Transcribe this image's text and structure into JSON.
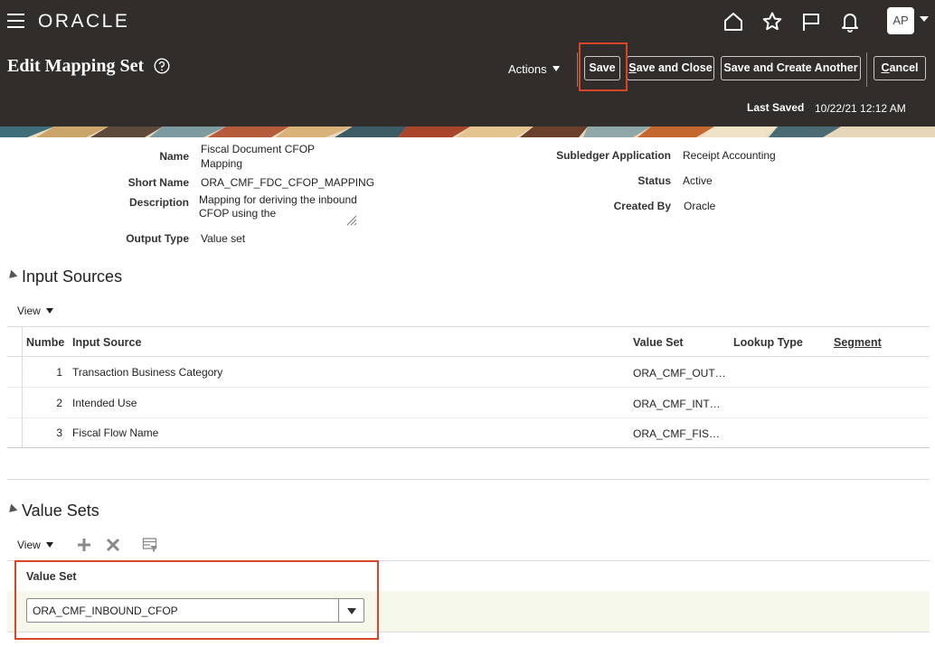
{
  "header": {
    "brand": "ORACLE",
    "avatar_initials": "AP",
    "page_title": "Edit Mapping Set",
    "actions_label": "Actions",
    "buttons": {
      "save": "Save",
      "save_close_first": "S",
      "save_close_rest": "ave and Close",
      "save_create": "Save and Create Another",
      "cancel_first": "C",
      "cancel_rest": "ancel"
    },
    "last_saved_label": "Last Saved",
    "last_saved_value": "10/22/21 12:12 AM"
  },
  "form": {
    "name_label": "Name",
    "name_line1": "Fiscal Document CFOP",
    "name_line2": "Mapping",
    "short_name_label": "Short Name",
    "short_name_value": "ORA_CMF_FDC_CFOP_MAPPING",
    "description_label": "Description",
    "description_value": "Mapping for deriving the inbound CFOP using the",
    "output_type_label": "Output Type",
    "output_type_value": "Value set",
    "subledger_label": "Subledger Application",
    "subledger_value": "Receipt Accounting",
    "status_label": "Status",
    "status_value": "Active",
    "created_by_label": "Created By",
    "created_by_value": "Oracle"
  },
  "input_sources": {
    "title": "Input Sources",
    "view_label": "View",
    "columns": {
      "number": "Numbe",
      "input_source": "Input Source",
      "value_set": "Value Set",
      "lookup_type": "Lookup Type",
      "segment": "Segment"
    },
    "rows": [
      {
        "number": "1",
        "input_source": "Transaction Business Category",
        "value_set": "ORA_CMF_OUT…"
      },
      {
        "number": "2",
        "input_source": "Intended Use",
        "value_set": "ORA_CMF_INT…"
      },
      {
        "number": "3",
        "input_source": "Fiscal Flow Name",
        "value_set": "ORA_CMF_FIS…"
      }
    ]
  },
  "value_sets": {
    "title": "Value Sets",
    "view_label": "View",
    "column": "Value Set",
    "selected_value": "ORA_CMF_INBOUND_CFOP"
  },
  "colors": {
    "header_bg": "#312d2a",
    "highlight": "#d9452a",
    "row_highlight": "#f7f8ec"
  }
}
